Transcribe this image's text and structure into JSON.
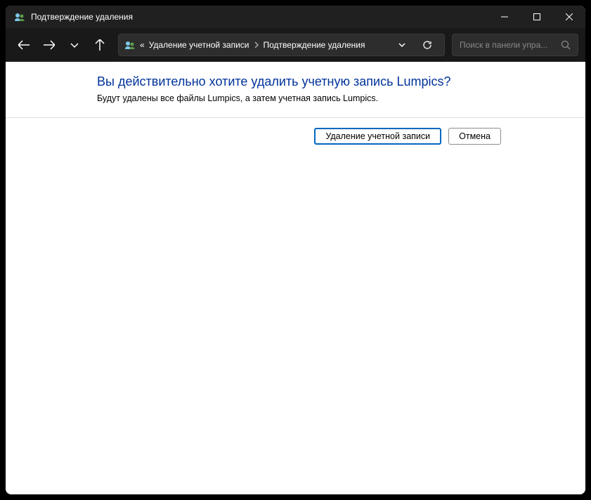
{
  "window": {
    "title": "Подтверждение удаления"
  },
  "breadcrumb": {
    "prefix": "«",
    "part1": "Удаление учетной записи",
    "part2": "Подтверждение удаления"
  },
  "search": {
    "placeholder": "Поиск в панели упра..."
  },
  "content": {
    "heading": "Вы действительно хотите удалить учетную запись Lumpics?",
    "description": "Будут удалены все файлы Lumpics, а затем учетная запись Lumpics."
  },
  "buttons": {
    "delete": "Удаление учетной записи",
    "cancel": "Отмена"
  }
}
